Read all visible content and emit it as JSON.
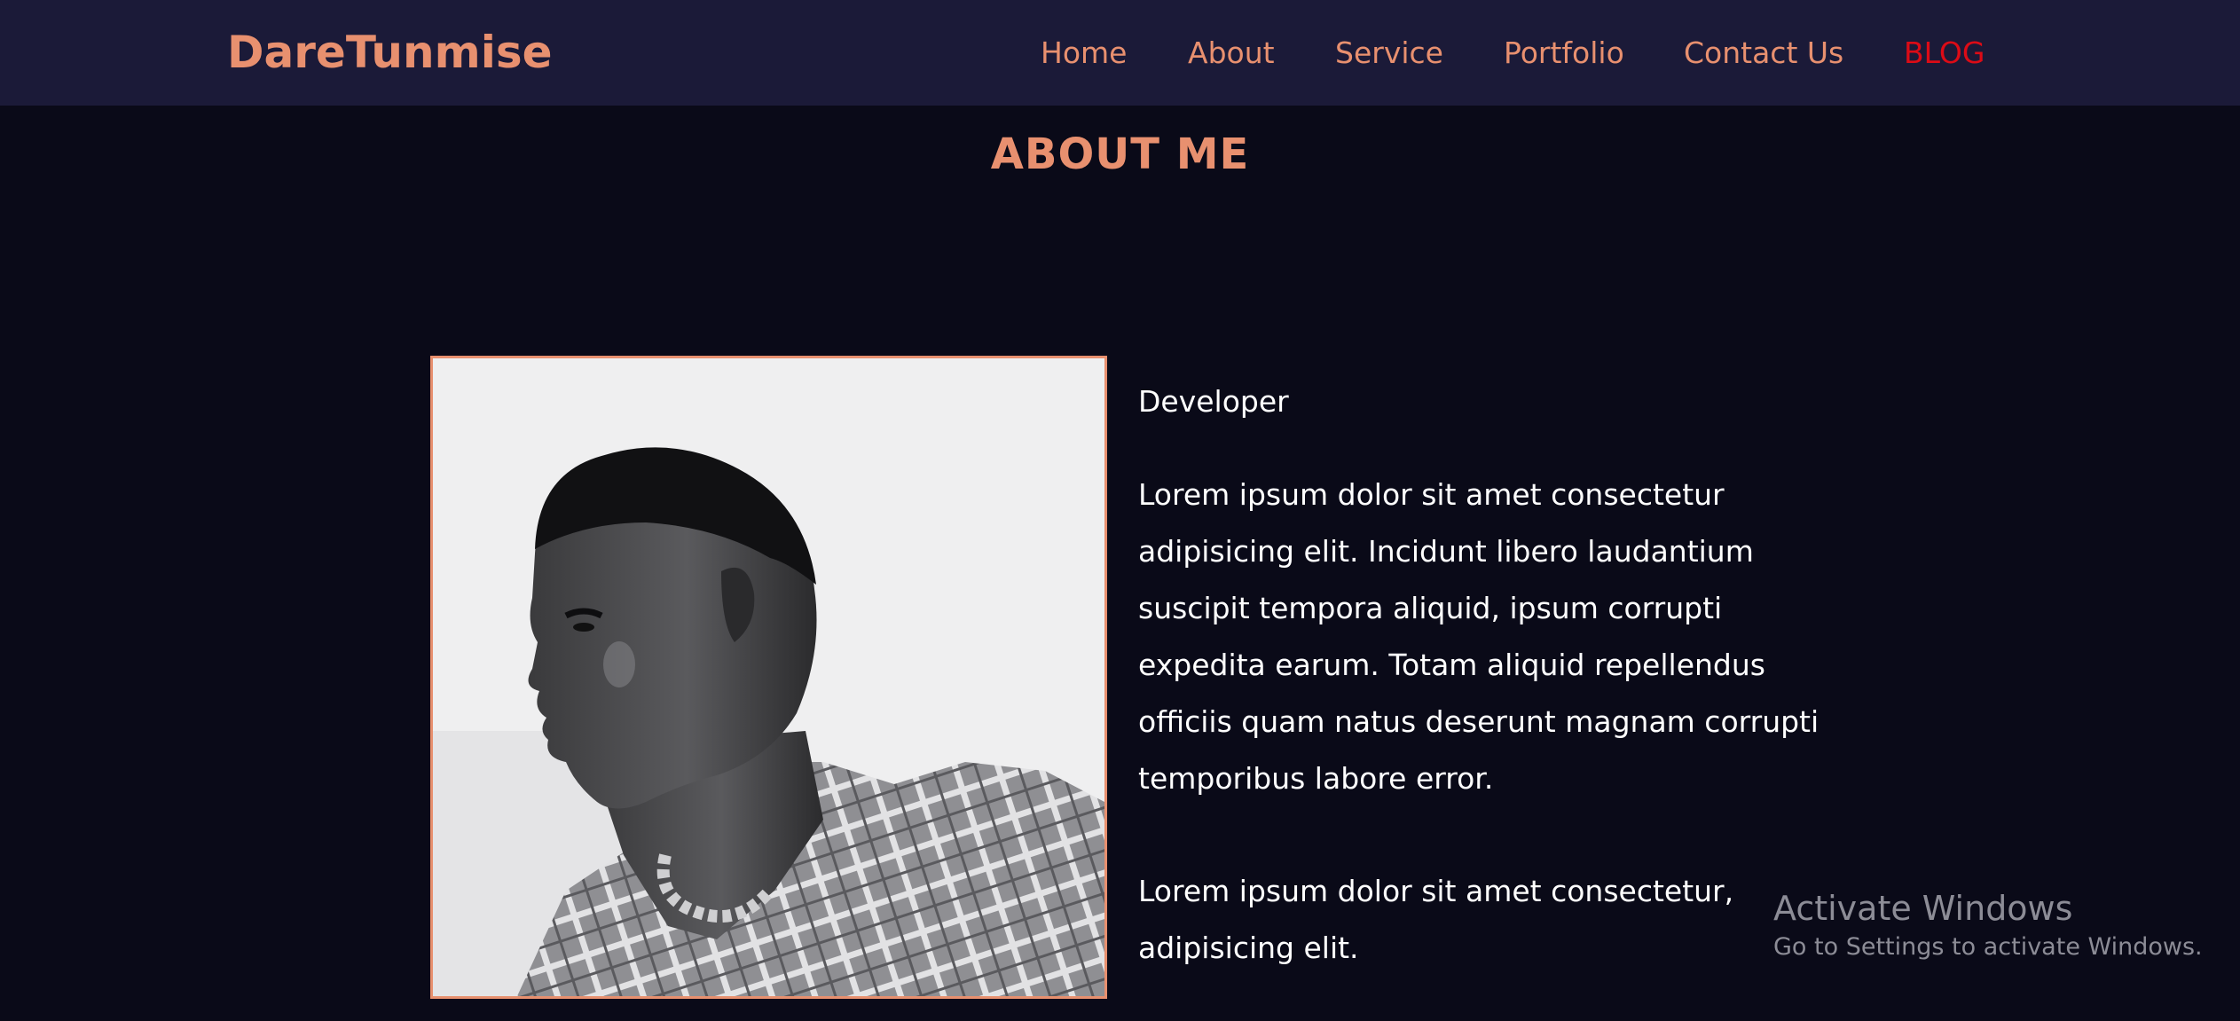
{
  "brand": "DareTunmise",
  "nav": {
    "items": [
      {
        "label": "Home"
      },
      {
        "label": "About"
      },
      {
        "label": "Service"
      },
      {
        "label": "Portfolio"
      },
      {
        "label": "Contact Us"
      },
      {
        "label": "BLOG"
      }
    ]
  },
  "about": {
    "title": "ABOUT ME",
    "role": "Developer",
    "paragraph1": "Lorem ipsum dolor sit amet consectetur adipisicing elit. Incidunt libero laudantium suscipit tempora aliquid, ipsum corrupti expedita earum. Totam aliquid repellendus officiis quam natus deserunt magnam corrupti temporibus labore error.",
    "paragraph2": "Lorem ipsum dolor sit amet consectetur, adipisicing elit."
  },
  "watermark": {
    "title": "Activate Windows",
    "subtitle": "Go to Settings to activate Windows."
  },
  "colors": {
    "accent": "#e8906f",
    "blog": "#dc0b16",
    "navbar_bg": "#1b1a38",
    "page_bg": "#0a0a18",
    "text": "#ffffff"
  }
}
